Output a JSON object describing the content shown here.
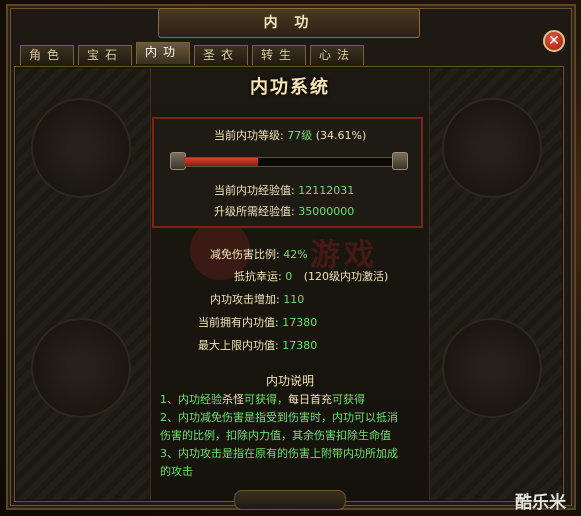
{
  "window": {
    "title": "内 功",
    "close_symbol": "✕"
  },
  "tabs": [
    {
      "label": "角色",
      "active": false
    },
    {
      "label": "宝石",
      "active": false
    },
    {
      "label": "内功",
      "active": true
    },
    {
      "label": "圣衣",
      "active": false
    },
    {
      "label": "转生",
      "active": false
    },
    {
      "label": "心法",
      "active": false
    }
  ],
  "panel": {
    "heading": "内功系统",
    "level_label": "当前内功等级:",
    "level_value": "77级",
    "level_percent": "(34.61%)",
    "progress_fraction": 0.3461,
    "exp_label": "当前内功经验值:",
    "exp_value": "12112031",
    "next_exp_label": "升级所需经验值:",
    "next_exp_value": "35000000"
  },
  "stats": {
    "reduce_label": "减免伤害比例:",
    "reduce_value": "42%",
    "luck_label": "抵抗幸运:",
    "luck_value": "0",
    "luck_note": "(120级内功激活)",
    "attack_label": "内功攻击增加:",
    "attack_value": "110",
    "current_label": "当前拥有内功值:",
    "current_value": "17380",
    "max_label": "最大上限内功值:",
    "max_value": "17380"
  },
  "description": {
    "title": "内功说明",
    "line1_a": "1、内功经验",
    "line1_b": "杀怪",
    "line1_c": "可获得，",
    "line1_d": "每日首充",
    "line1_e": "可获得",
    "line2": "2、内功减免伤害是指受到伤害时，内功可以抵消",
    "line3": "伤害的比例，扣除内力值，其余伤害扣除生命值",
    "line4": "3、内功攻击是指在原有的伤害上附带内功所加成",
    "line5": "的攻击"
  },
  "watermark": "游戏",
  "site_mark": "酷乐米",
  "colors": {
    "value_green": "#6ee06e",
    "label_cream": "#f0e4b8",
    "frame_red": "#7a2418",
    "bar_red": "#e04030"
  },
  "icons": {
    "close": "close-icon"
  }
}
